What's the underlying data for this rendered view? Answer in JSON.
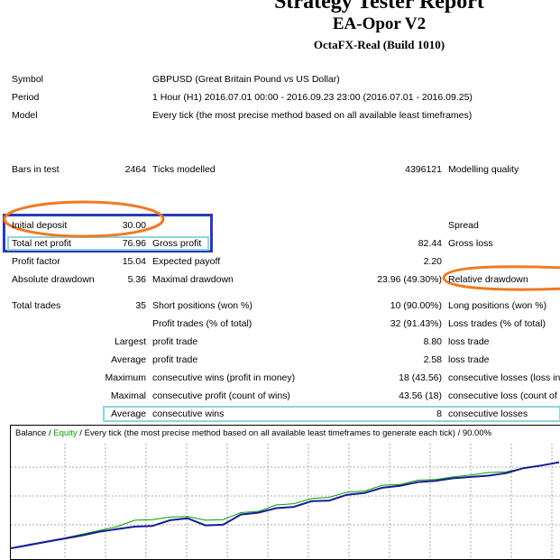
{
  "header": {
    "title": "Strategy Tester Report",
    "ea_name": "EA-Opor V2",
    "server": "OctaFX-Real (Build 1010)"
  },
  "info": {
    "symbol_label": "Symbol",
    "symbol_value": "GBPUSD (Great Britain Pound vs US Dollar)",
    "period_label": "Period",
    "period_value": "1 Hour (H1) 2016.07.01 00:00 - 2016.09.23 23:00 (2016.07.01 - 2016.09.25)",
    "model_label": "Model",
    "model_value": "Every tick (the most precise method based on all available least timeframes)"
  },
  "bars": {
    "bars_label": "Bars in test",
    "bars_value": "2464",
    "ticks_label": "Ticks modelled",
    "ticks_value": "4396121",
    "quality_label": "Modelling quality"
  },
  "stats": {
    "initial_deposit_label": "Initial deposit",
    "initial_deposit_value": "30.00",
    "spread_label": "Spread",
    "net_profit_label": "Total net profit",
    "net_profit_value": "76.96",
    "gross_profit_label": "Gross profit",
    "gross_profit_value": "82.44",
    "gross_loss_label": "Gross loss",
    "profit_factor_label": "Profit factor",
    "profit_factor_value": "15.04",
    "expected_payoff_label": "Expected payoff",
    "expected_payoff_value": "2.20",
    "abs_drawdown_label": "Absolute drawdown",
    "abs_drawdown_value": "5.36",
    "max_drawdown_label": "Maximal drawdown",
    "max_drawdown_value": "23.96 (49.30%)",
    "rel_drawdown_label": "Relative drawdown"
  },
  "trades": {
    "total_trades_label": "Total trades",
    "total_trades_value": "35",
    "short_label": "Short positions (won %)",
    "short_value": "10 (90.00%)",
    "long_label": "Long positions (won %)",
    "profit_trades_label": "Profit trades (% of total)",
    "profit_trades_value": "32 (91.43%)",
    "loss_trades_label": "Loss trades (% of total)",
    "largest_label": "Largest",
    "largest_profit_label": "profit trade",
    "largest_profit_value": "8.80",
    "largest_loss_label": "loss trade",
    "average_label": "Average",
    "average_profit_label": "profit trade",
    "average_profit_value": "2.58",
    "average_loss_label": "loss trade",
    "maximum_label": "Maximum",
    "max_cons_wins_label": "consecutive wins (profit in money)",
    "max_cons_wins_value": "18 (43.56)",
    "max_cons_losses_label": "consecutive losses (loss in",
    "maximal_label": "Maximal",
    "maximal_profit_label": "consecutive profit (count of wins)",
    "maximal_profit_value": "43.56 (18)",
    "maximal_loss_label": "consecutive loss (count of",
    "avg_label": "Average",
    "avg_wins_label": "consecutive wins",
    "avg_wins_value": "8",
    "avg_losses_label": "consecutive losses"
  },
  "chart_caption": {
    "balance": "Balance",
    "sep1": " / ",
    "equity": "Equity",
    "rest": " / Every tick (the most precise method based on all available least timeframes to generate each tick) / 90.00%"
  },
  "colors": {
    "orange_annotation": "#ee7a22",
    "blue_annotation": "#2b3ab4",
    "cyan_annotation": "#8fd3e0",
    "balance_line": "#1a1a99",
    "equity_line": "#00a000"
  },
  "chart_data": {
    "type": "line",
    "series": [
      {
        "name": "Balance",
        "values": [
          0,
          0.5,
          1.0,
          1.5,
          2.0,
          2.6,
          3.0,
          3.4,
          3.5,
          4.4,
          4.7,
          3.6,
          3.7,
          5.3,
          5.6,
          6.3,
          6.5,
          7.4,
          7.5,
          8.4,
          8.7,
          9.5,
          9.8,
          10.4,
          10.6,
          11.0,
          11.2,
          11.4,
          11.8,
          12.6,
          13.0,
          13.5
        ]
      },
      {
        "name": "Equity",
        "values": [
          0,
          0.6,
          1.1,
          1.6,
          2.2,
          2.8,
          3.4,
          4.4,
          4.5,
          4.9,
          5.0,
          4.4,
          4.5,
          5.6,
          5.8,
          6.8,
          7.0,
          7.8,
          8.0,
          8.8,
          9.0,
          9.9,
          10.0,
          10.7,
          10.8,
          11.2,
          11.5,
          11.9,
          12.0,
          12.6,
          13.0,
          13.6
        ]
      }
    ]
  }
}
